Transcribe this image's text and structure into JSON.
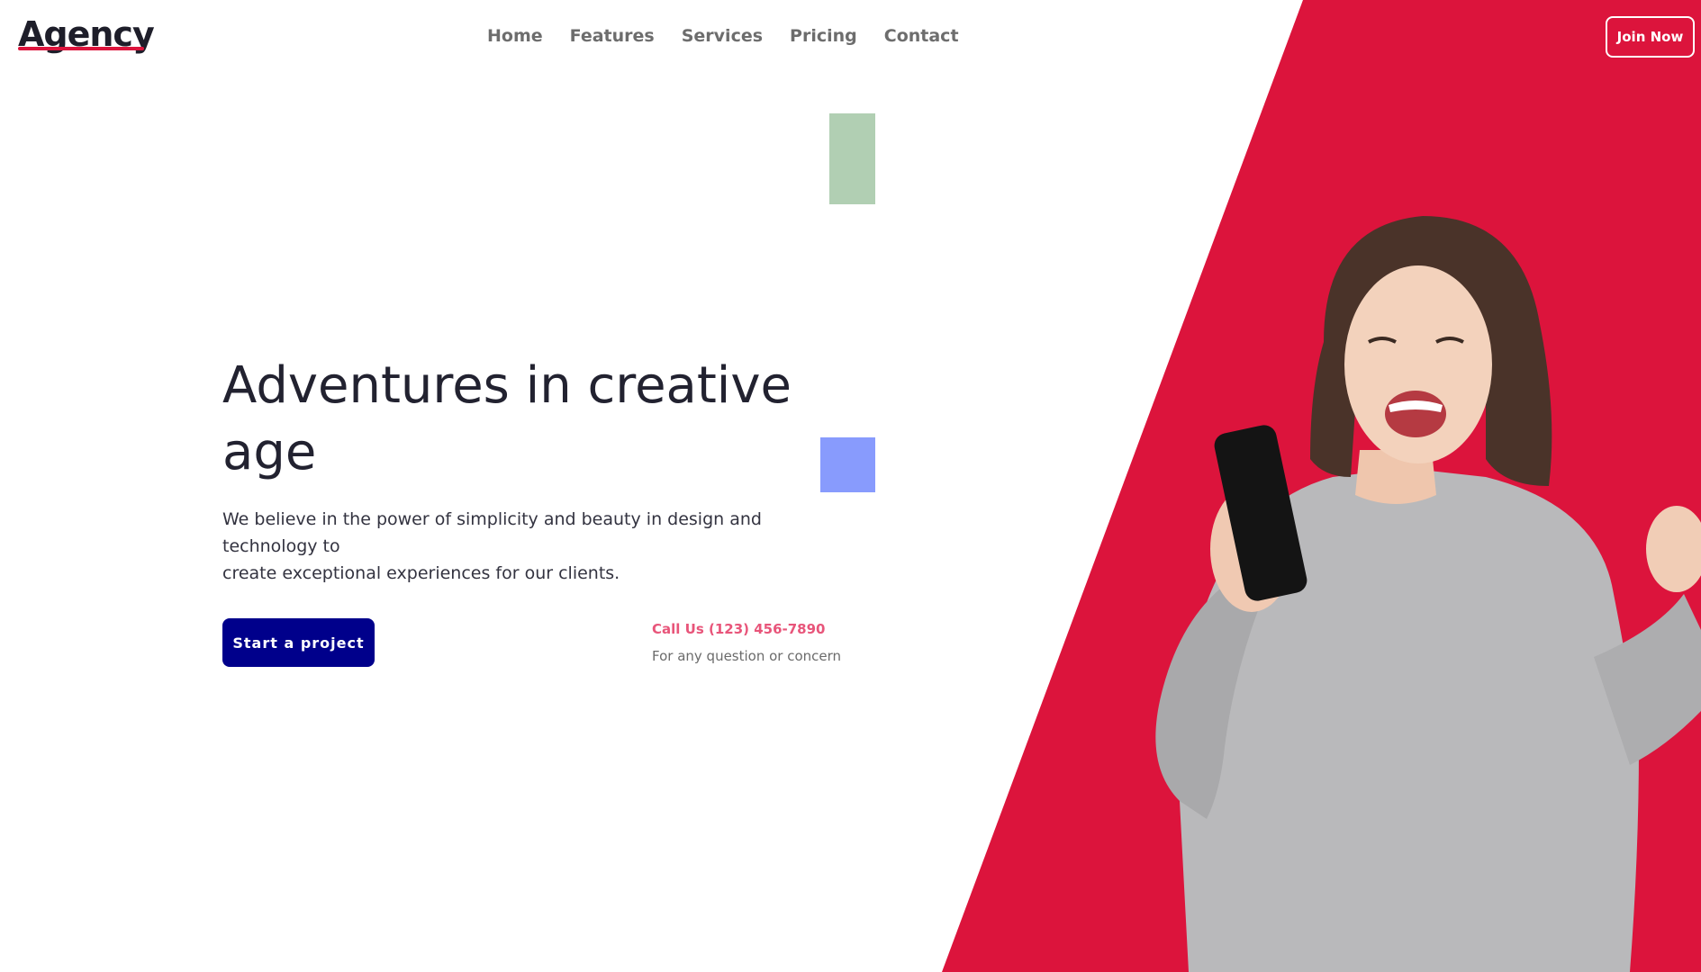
{
  "brand": {
    "logo_text": "Agency",
    "accent_color": "#dc143c",
    "primary_color": "#00008b"
  },
  "nav": {
    "items": [
      {
        "label": "Home"
      },
      {
        "label": "Features"
      },
      {
        "label": "Services"
      },
      {
        "label": "Pricing"
      },
      {
        "label": "Contact"
      }
    ]
  },
  "header": {
    "join_label": "Join Now"
  },
  "hero": {
    "title_line1": "Adventures in creative",
    "title_line2": "age",
    "description_line1": "We believe in the power of simplicity and beauty in design and technology to",
    "description_line2": "create exceptional experiences for our clients.",
    "cta_label": "Start a project",
    "call_label": "Call Us (123) 456-7890",
    "call_sub": "For any question or concern"
  },
  "decor": {
    "green_square_color": "#b1cfb3",
    "blue_square_color": "#889bfd"
  },
  "image": {
    "icon": "person-with-phone-photo"
  }
}
